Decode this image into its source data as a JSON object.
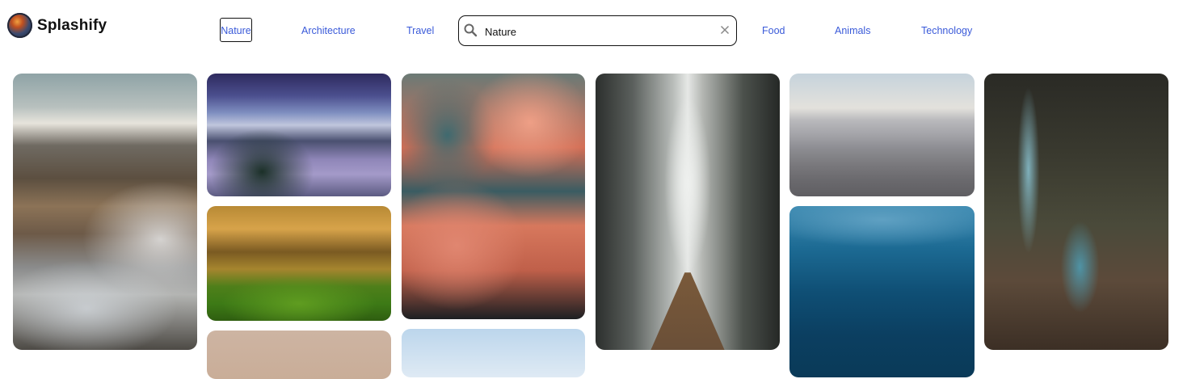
{
  "app": {
    "name": "Splashify",
    "avatar_icon": "avatar-icon"
  },
  "nav": {
    "active": "Nature",
    "links": [
      "Nature",
      "Architecture",
      "Travel",
      "Food",
      "Animals",
      "Technology"
    ]
  },
  "search": {
    "value": "Nature",
    "placeholder": "",
    "icon": "search-icon",
    "clear_icon": "close-icon"
  },
  "gallery": {
    "images": [
      {
        "subject": "mountain-landscape"
      },
      {
        "subject": "snowy-valley"
      },
      {
        "subject": "autumn-forest"
      },
      {
        "subject": "beige-photo"
      },
      {
        "subject": "red-clouds"
      },
      {
        "subject": "sky-flowers"
      },
      {
        "subject": "foggy-forest-road"
      },
      {
        "subject": "misty-hills"
      },
      {
        "subject": "underwater-ocean"
      },
      {
        "subject": "forest-river"
      }
    ]
  },
  "colors": {
    "link": "#3a5ad9",
    "text": "#111111",
    "background": "#ffffff"
  }
}
